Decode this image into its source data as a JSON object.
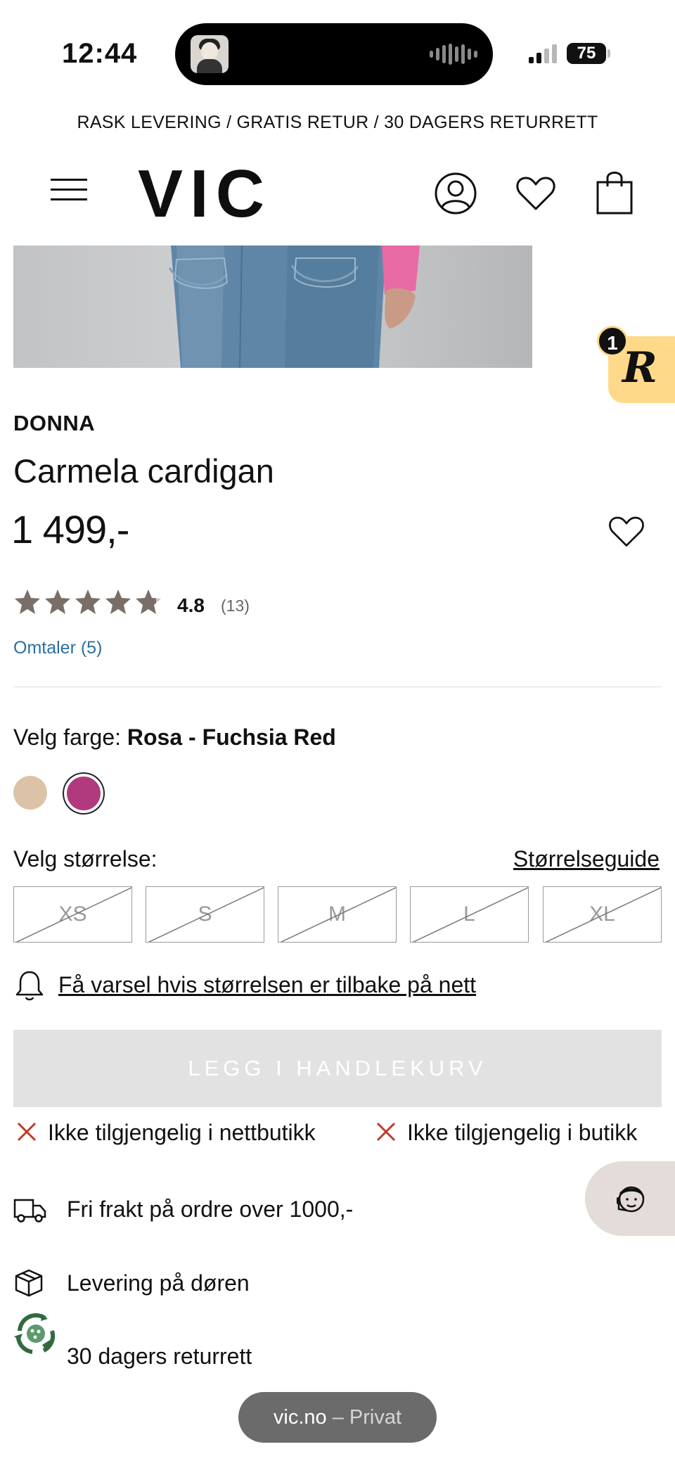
{
  "status_bar": {
    "time": "12:44",
    "battery": "75"
  },
  "promo": {
    "text": "RASK LEVERING / GRATIS RETUR / 30 DAGERS RETURRETT"
  },
  "header": {
    "logo": "VIC"
  },
  "badge": {
    "letter": "R",
    "count": "1"
  },
  "product": {
    "brand": "DONNA",
    "title": "Carmela cardigan",
    "price": "1 499,-",
    "rating": "4.8",
    "rating_value": 4.8,
    "rating_max": 5,
    "rating_count": "(13)",
    "reviews_link": "Omtaler (5)"
  },
  "color": {
    "label": "Velg farge:",
    "selected": "Rosa - Fuchsia Red",
    "swatches": [
      "#dcc3a8",
      "#b13a7f"
    ]
  },
  "size": {
    "label": "Velg størrelse:",
    "guide": "Størrelseguide",
    "options": [
      "XS",
      "S",
      "M",
      "L",
      "XL"
    ],
    "notify": "Få varsel hvis størrelsen er tilbake på nett"
  },
  "cart": {
    "button": "LEGG I HANDLEKURV"
  },
  "availability": {
    "online": "Ikke tilgjengelig i nettbutikk",
    "store": "Ikke tilgjengelig i butikk"
  },
  "usps": {
    "shipping": "Fri frakt på ordre over 1000,-",
    "delivery": "Levering på døren",
    "returns": "30 dagers returrett"
  },
  "browser": {
    "domain": "vic.no",
    "mode": "– Privat"
  },
  "colors": {
    "accent_link": "#2a6fa0",
    "badge_bg": "#ffd98a",
    "star": "#7a6f68"
  }
}
